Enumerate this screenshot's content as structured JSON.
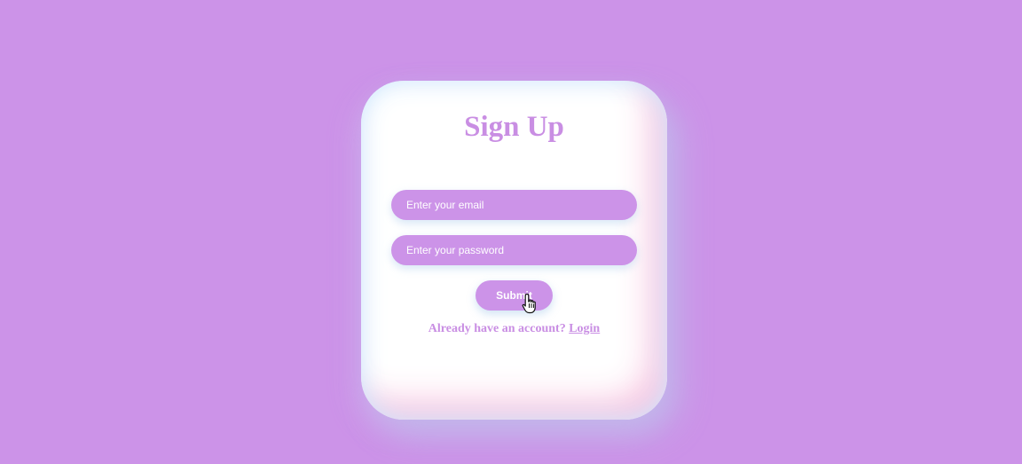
{
  "form": {
    "title": "Sign Up",
    "email_placeholder": "Enter your email",
    "password_placeholder": "Enter your password",
    "submit_label": "Submit",
    "account_prompt": "Already have an account?",
    "login_label": "Login"
  },
  "icons": {
    "cursor": "hand-pointer-icon"
  },
  "colors": {
    "background": "#cc93e8",
    "accent": "#c98ee3",
    "card": "#ffffff"
  }
}
